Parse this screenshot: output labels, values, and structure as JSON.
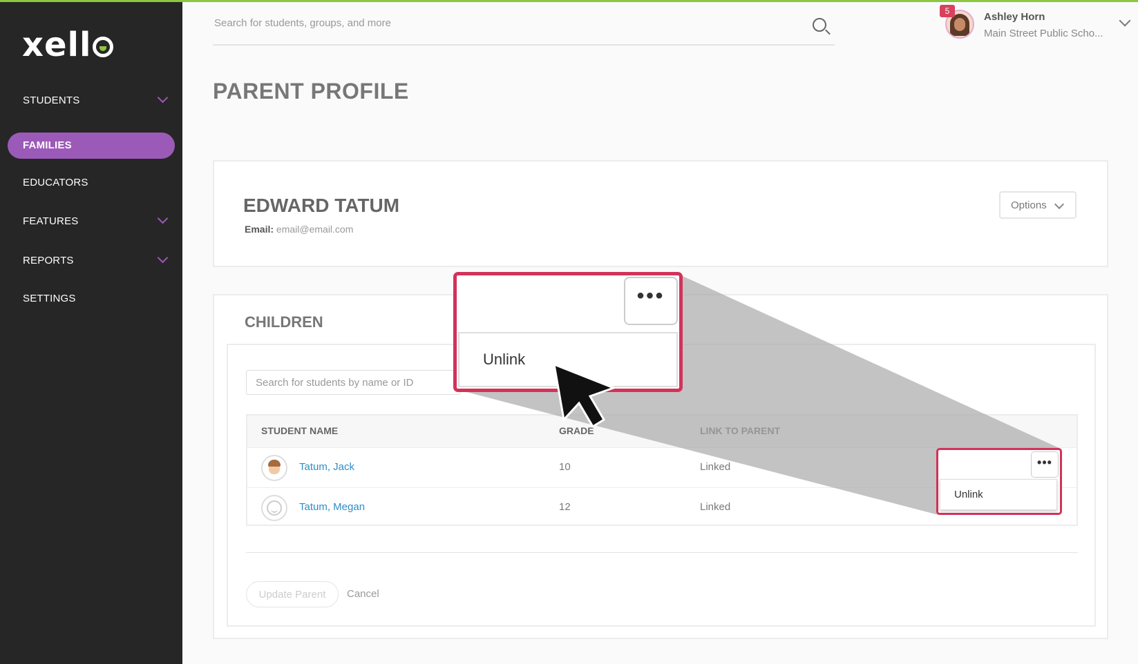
{
  "sidebar": {
    "logo": "xell",
    "items": [
      {
        "label": "STUDENTS",
        "has_chevron": true
      },
      {
        "label": "FAMILIES",
        "active": true
      },
      {
        "label": "EDUCATORS"
      },
      {
        "label": "FEATURES",
        "has_chevron": true
      },
      {
        "label": "REPORTS",
        "has_chevron": true
      },
      {
        "label": "SETTINGS"
      }
    ]
  },
  "header": {
    "search_placeholder": "Search for students, groups, and more",
    "user": {
      "name": "Ashley Horn",
      "school": "Main Street Public Scho...",
      "notification_count": "5"
    }
  },
  "page": {
    "title": "PARENT PROFILE",
    "parent": {
      "name": "EDWARD TATUM",
      "email_label": "Email",
      "email": "email@email.com",
      "options_label": "Options"
    },
    "children": {
      "title": "CHILDREN",
      "search_placeholder": "Search for students by name or ID",
      "columns": [
        "STUDENT NAME",
        "GRADE",
        "LINK TO PARENT"
      ],
      "rows": [
        {
          "name": "Tatum, Jack",
          "grade": "10",
          "link": "Linked"
        },
        {
          "name": "Tatum, Megan",
          "grade": "12",
          "link": "Linked"
        }
      ],
      "update_label": "Update Parent",
      "cancel_label": "Cancel"
    }
  },
  "context_menu": {
    "dots": "•••",
    "unlink_label": "Unlink"
  },
  "colors": {
    "accent_purple": "#9c5ab8",
    "top_green": "#8dc63f",
    "highlight_red": "#d2325a",
    "link_blue": "#2f8dc6"
  }
}
